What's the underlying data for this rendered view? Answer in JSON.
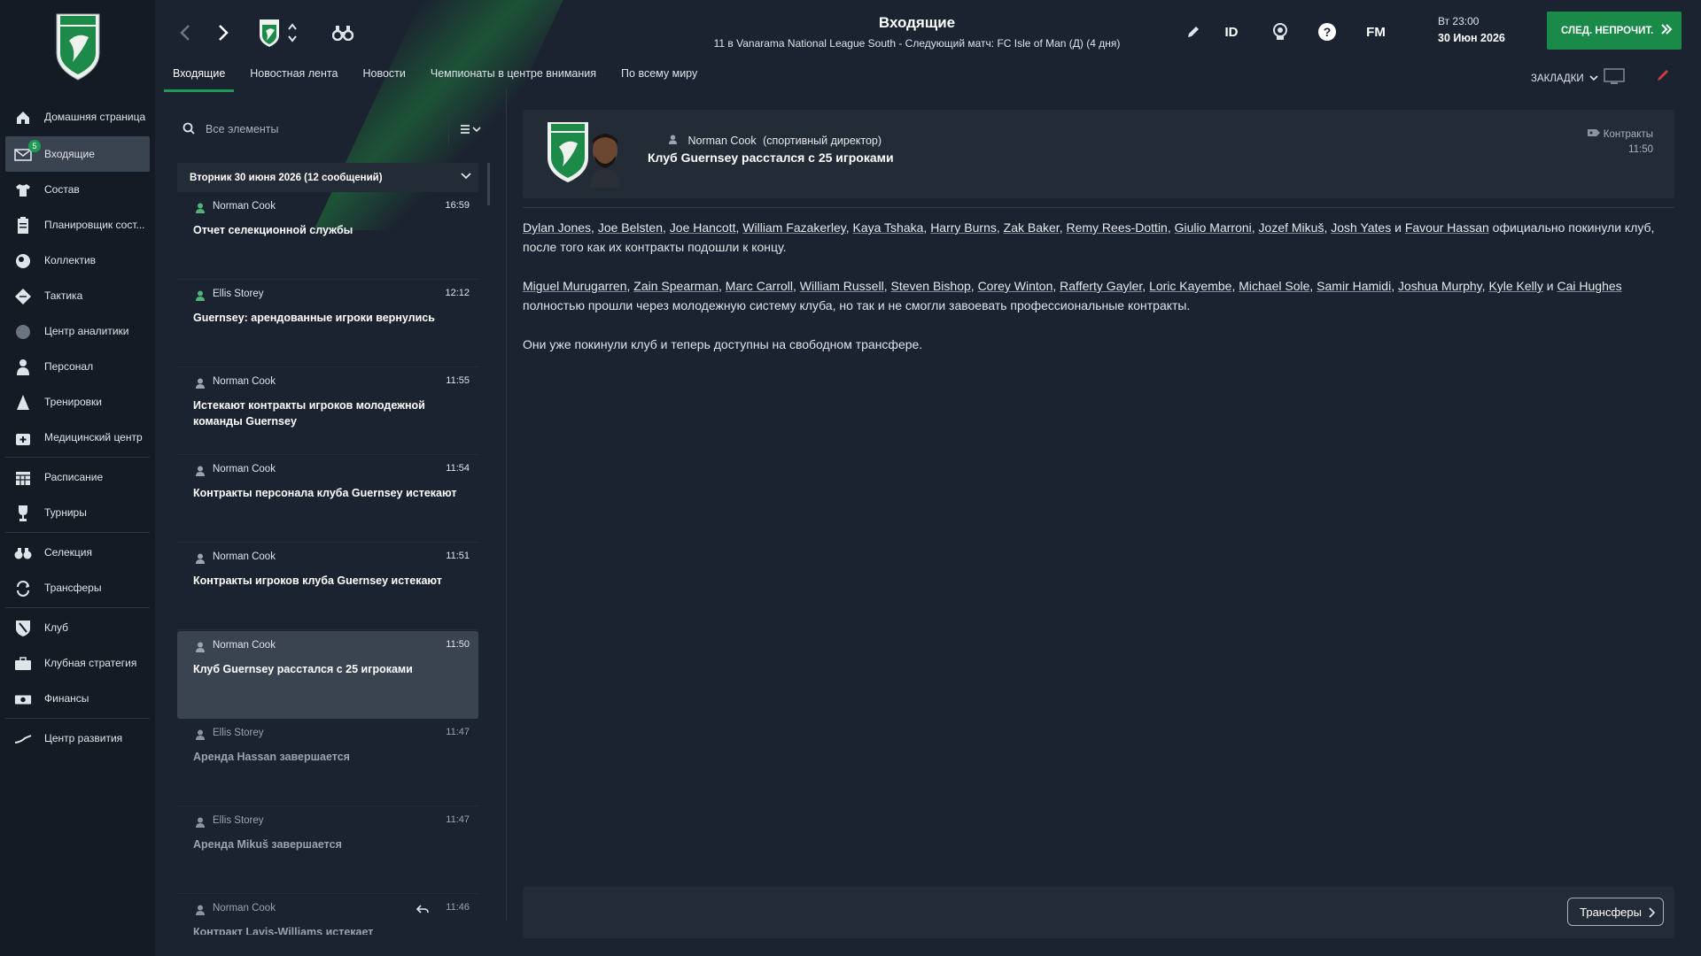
{
  "header": {
    "title": "Входящие",
    "subtitle": "11 в Vanarama National League South - Следующий матч: FC Isle of Man (Д) (4 дня)",
    "id_label": "ID",
    "fm_label": "FM",
    "day_time": "Вт 23:00",
    "date": "30 Июн 2026",
    "continue_label": "СЛЕД. НЕПРОЧИТ.",
    "bookmarks_label": "ЗАКЛАДКИ"
  },
  "tabs": [
    {
      "label": "Входящие"
    },
    {
      "label": "Новостная лента"
    },
    {
      "label": "Новости"
    },
    {
      "label": "Чемпионаты в центре внимания"
    },
    {
      "label": "По всему миру"
    }
  ],
  "sidebar": {
    "badge": "5",
    "items": [
      {
        "label": "Домашняя страница",
        "icon": "home-icon"
      },
      {
        "label": "Входящие",
        "icon": "inbox-icon"
      },
      {
        "label": "Состав",
        "icon": "shirt-icon"
      },
      {
        "label": "Планировщик сост...",
        "icon": "planner-icon"
      },
      {
        "label": "Коллектив",
        "icon": "dynamics-icon"
      },
      {
        "label": "Тактика",
        "icon": "tactics-icon"
      },
      {
        "label": "Центр аналитики",
        "icon": "analytics-icon"
      },
      {
        "label": "Персонал",
        "icon": "staff-icon"
      },
      {
        "label": "Тренировки",
        "icon": "training-icon"
      },
      {
        "label": "Медицинский центр",
        "icon": "medical-icon"
      },
      {
        "label": "Расписание",
        "icon": "schedule-icon"
      },
      {
        "label": "Турниры",
        "icon": "trophy-icon"
      },
      {
        "label": "Селекция",
        "icon": "scouting-icon"
      },
      {
        "label": "Трансферы",
        "icon": "transfers-icon"
      },
      {
        "label": "Клуб",
        "icon": "club-icon"
      },
      {
        "label": "Клубная стратегия",
        "icon": "strategy-icon"
      },
      {
        "label": "Финансы",
        "icon": "finances-icon"
      },
      {
        "label": "Центр развития",
        "icon": "development-icon"
      }
    ]
  },
  "list": {
    "search_placeholder": "Все элементы",
    "group_label": "Вторник 30 июня 2026 (12 сообщений)",
    "messages": [
      {
        "sender": "Norman Cook",
        "time": "16:59",
        "subject": "Отчет селекционной службы"
      },
      {
        "sender": "Ellis Storey",
        "time": "12:12",
        "subject": "Guernsey: арендованные игроки вернулись"
      },
      {
        "sender": "Norman Cook",
        "time": "11:55",
        "subject": "Истекают контракты игроков молодежной команды Guernsey"
      },
      {
        "sender": "Norman Cook",
        "time": "11:54",
        "subject": "Контракты персонала клуба Guernsey истекают"
      },
      {
        "sender": "Norman Cook",
        "time": "11:51",
        "subject": "Контракты игроков клуба Guernsey истекают"
      },
      {
        "sender": "Norman Cook",
        "time": "11:50",
        "subject": "Клуб Guernsey расстался с 25 игроками"
      },
      {
        "sender": "Ellis Storey",
        "time": "11:47",
        "subject": "Аренда Hassan завершается"
      },
      {
        "sender": "Ellis Storey",
        "time": "11:47",
        "subject": "Аренда Mikuš завершается"
      },
      {
        "sender": "Norman Cook",
        "time": "11:46",
        "subject": "Контракт Lavis-Williams истекает"
      }
    ]
  },
  "detail": {
    "from_name": "Norman Cook",
    "from_role": "(спортивный директор)",
    "subject": "Клуб Guernsey расстался с 25 игроками",
    "category": "Контракты",
    "time": "11:50",
    "p1_players": [
      "Dylan Jones",
      "Joe Belsten",
      "Joe Hancott",
      "William Fazakerley",
      "Kaya Tshaka",
      "Harry Burns",
      "Zak Baker",
      "Remy Rees-Dottin",
      "Giulio Marroni",
      "Jozef Mikuš",
      "Josh Yates"
    ],
    "p1_and": "и",
    "p1_last": "Favour Hassan",
    "p1_text": "официально покинули клуб, после того как их контракты подошли к концу.",
    "p2_players": [
      "Miguel Murugarren",
      "Zain Spearman",
      "Marc Carroll",
      "William Russell",
      "Steven Bishop",
      "Corey Winton",
      "Rafferty Gayler",
      "Loric Kayembe",
      "Michael Sole",
      "Samir Hamidi",
      "Joshua Murphy",
      "Kyle Kelly"
    ],
    "p2_and": "и",
    "p2_last": "Cai Hughes",
    "p2_text": "полностью прошли через молодежную систему клуба, но так и не смогли завоевать профессиональные контракты.",
    "p3_text": "Они уже покинули клуб и теперь доступны на свободном трансфере.",
    "footer_button": "Трансферы"
  },
  "colors": {
    "accent": "#198a48",
    "background": "#1b2330",
    "sidebar": "#151b24",
    "panel": "#232b37"
  }
}
